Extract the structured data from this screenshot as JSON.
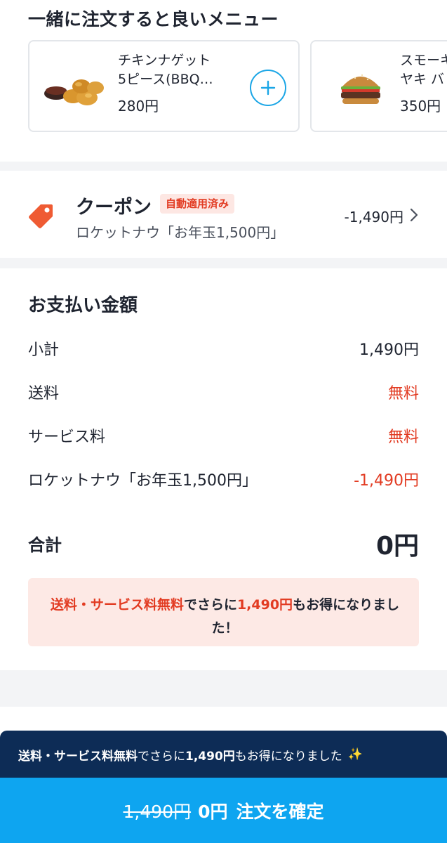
{
  "recommend": {
    "title": "一緒に注文すると良いメニュー",
    "items": [
      {
        "name": "チキンナゲット\n5ピース(BBQ…",
        "price": "280円",
        "icon": "chicken-nuggets-image"
      },
      {
        "name": "スモーキ\nヤキ バ",
        "price": "350円",
        "icon": "burger-image"
      }
    ]
  },
  "coupon": {
    "title": "クーポン",
    "badge": "自動適用済み",
    "name": "ロケットナウ「お年玉1,500円」",
    "amount": "-1,490円",
    "icon": "tag-icon"
  },
  "payment": {
    "title": "お支払い金額",
    "rows": [
      {
        "label": "小計",
        "value": "1,490円"
      },
      {
        "label": "送料",
        "value": "無料"
      },
      {
        "label": "サービス料",
        "value": "無料"
      },
      {
        "label": "ロケットナウ「お年玉1,500円」",
        "value": "-1,490円"
      }
    ],
    "total_label": "合計",
    "total_value": "0円",
    "notice": {
      "part1": "送料・サービス料無料",
      "part2": "でさらに",
      "part3": "1,490円",
      "part4": "もお得になりました！"
    }
  },
  "bottom": {
    "banner": {
      "part1": "送料・サービス料無料",
      "part2": "でさらに",
      "part3": "1,490円",
      "part4": "もお得になりました",
      "emoji": "✨"
    },
    "original_price": "1,490円",
    "new_price": "0円",
    "confirm_label": "注文を確定"
  },
  "colors": {
    "accent": "#0ea5f0",
    "discount": "#e23b22",
    "banner": "#0d2c56"
  }
}
